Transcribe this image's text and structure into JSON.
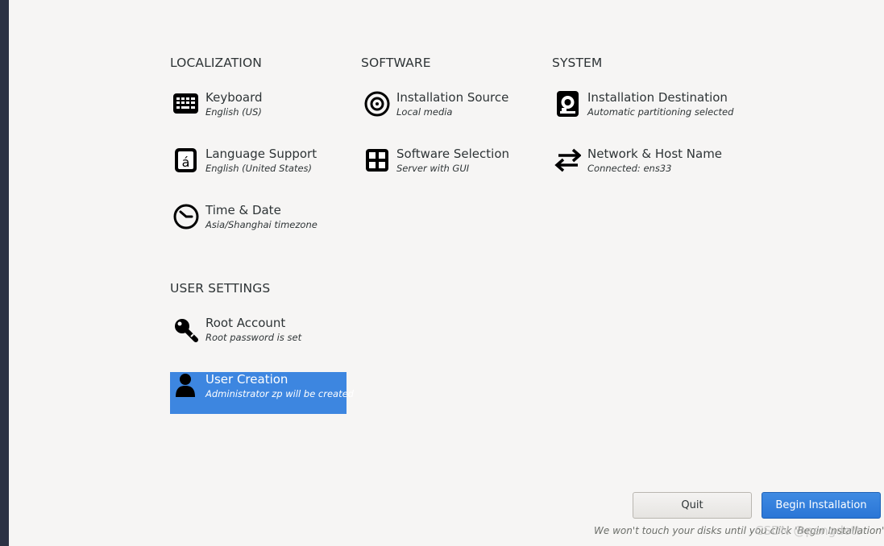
{
  "sections": {
    "localization": "LOCALIZATION",
    "software": "SOFTWARE",
    "system": "SYSTEM",
    "user_settings": "USER SETTINGS"
  },
  "spokes": {
    "keyboard": {
      "title": "Keyboard",
      "status": "English (US)",
      "icon": "keyboard-icon"
    },
    "language": {
      "title": "Language Support",
      "status": "English (United States)",
      "icon": "language-icon"
    },
    "time": {
      "title": "Time & Date",
      "status": "Asia/Shanghai timezone",
      "icon": "clock-icon"
    },
    "source": {
      "title": "Installation Source",
      "status": "Local media",
      "icon": "disc-icon"
    },
    "software": {
      "title": "Software Selection",
      "status": "Server with GUI",
      "icon": "package-icon"
    },
    "destination": {
      "title": "Installation Destination",
      "status": "Automatic partitioning selected",
      "icon": "harddisk-icon"
    },
    "network": {
      "title": "Network & Host Name",
      "status": "Connected: ens33",
      "icon": "network-arrows-icon"
    },
    "root": {
      "title": "Root Account",
      "status": "Root password is set",
      "icon": "key-icon"
    },
    "user": {
      "title": "User Creation",
      "status": "Administrator zp will be created",
      "icon": "user-icon",
      "selected": true
    }
  },
  "buttons": {
    "quit": "Quit",
    "begin": "Begin Installation"
  },
  "footnote": "We won't touch your disks until you click 'Begin Installation'.",
  "watermark": "CSDN @pengdott",
  "colors": {
    "background": "#f6f5f4",
    "selected": "#3d86e0",
    "accent_button": "#2a76d6",
    "rail": "#2c3244"
  }
}
